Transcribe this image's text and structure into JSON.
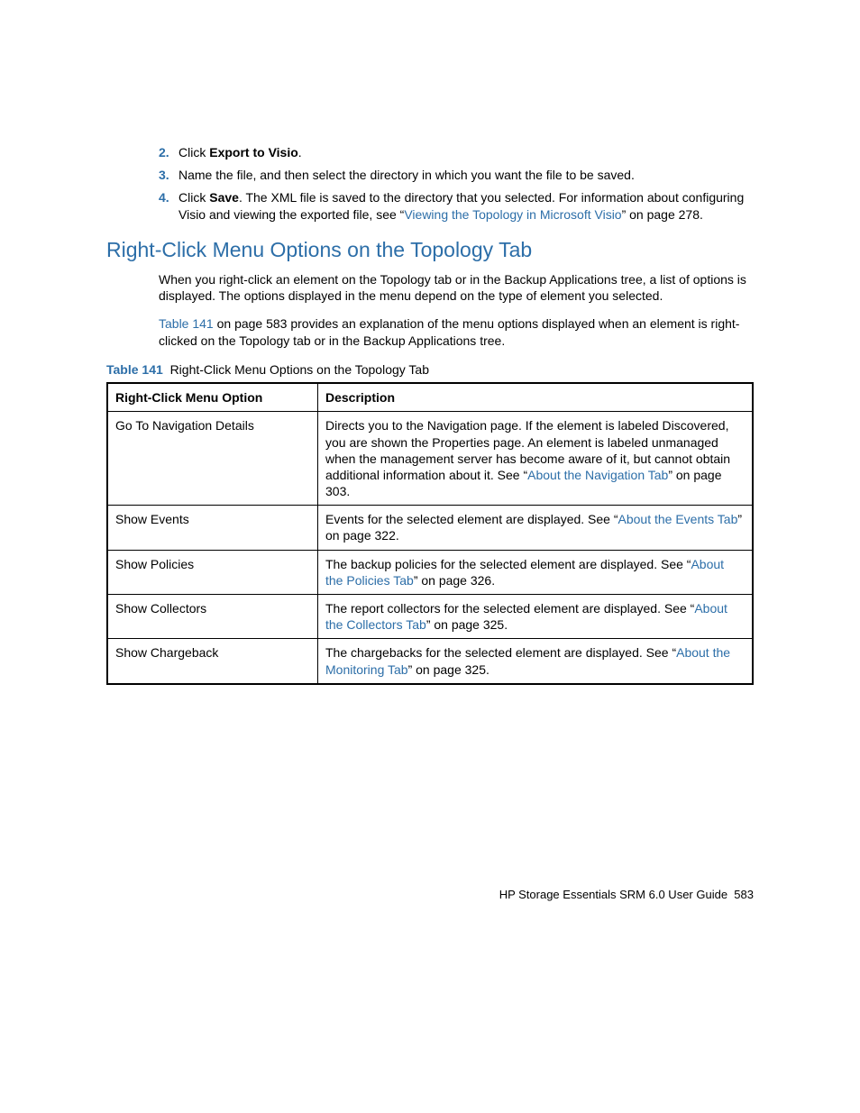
{
  "steps": [
    {
      "num": "2.",
      "prefix": "Click ",
      "bold": "Export to Visio",
      "suffix": "."
    },
    {
      "num": "3.",
      "text": "Name the file, and then select the directory in which you want the file to be saved."
    },
    {
      "num": "4.",
      "prefix": "Click ",
      "bold": "Save",
      "mid": ". The XML file is saved to the directory that you selected. For information about configuring Visio and viewing the exported file, see “",
      "link": "Viewing the Topology in Microsoft Visio",
      "suffix": "” on page 278."
    }
  ],
  "section_title": "Right-Click Menu Options on the Topology Tab",
  "intro1": "When you right-click an element on the Topology tab or in the Backup Applications tree, a list of options is displayed. The options displayed in the menu depend on the type of element you selected.",
  "intro2_link": "Table 141",
  "intro2_rest": " on page 583 provides an explanation of the menu options displayed when an element is right-clicked on the Topology tab or in the Backup Applications tree.",
  "table_label_strong": "Table 141",
  "table_label_rest": "Right-Click Menu Options on the Topology Tab",
  "table": {
    "headers": [
      "Right-Click Menu Option",
      "Description"
    ],
    "rows": [
      {
        "opt": "Go To Navigation Details",
        "desc_pre": "Directs you to the Navigation page. If the element is labeled Discovered, you are shown the Properties page. An element is labeled unmanaged when the management server has become aware of it, but cannot obtain additional information about it. See “",
        "desc_link": "About the Navigation Tab",
        "desc_post": "” on page 303."
      },
      {
        "opt": "Show Events",
        "desc_pre": "Events for the selected element are displayed. See “",
        "desc_link": "About the Events Tab",
        "desc_post": "” on page 322."
      },
      {
        "opt": "Show Policies",
        "desc_pre": "The backup policies for the selected element are displayed. See “",
        "desc_link": "About the Policies Tab",
        "desc_post": "” on page 326."
      },
      {
        "opt": "Show Collectors",
        "desc_pre": "The report collectors for the selected element are displayed. See “",
        "desc_link": "About the Collectors Tab",
        "desc_post": "” on page 325."
      },
      {
        "opt": "Show Chargeback",
        "desc_pre": "The chargebacks for the selected element are displayed. See “",
        "desc_link": "About the Monitoring Tab",
        "desc_post": "” on page 325."
      }
    ]
  },
  "footer_text": "HP Storage Essentials SRM 6.0 User Guide",
  "footer_page": "583"
}
